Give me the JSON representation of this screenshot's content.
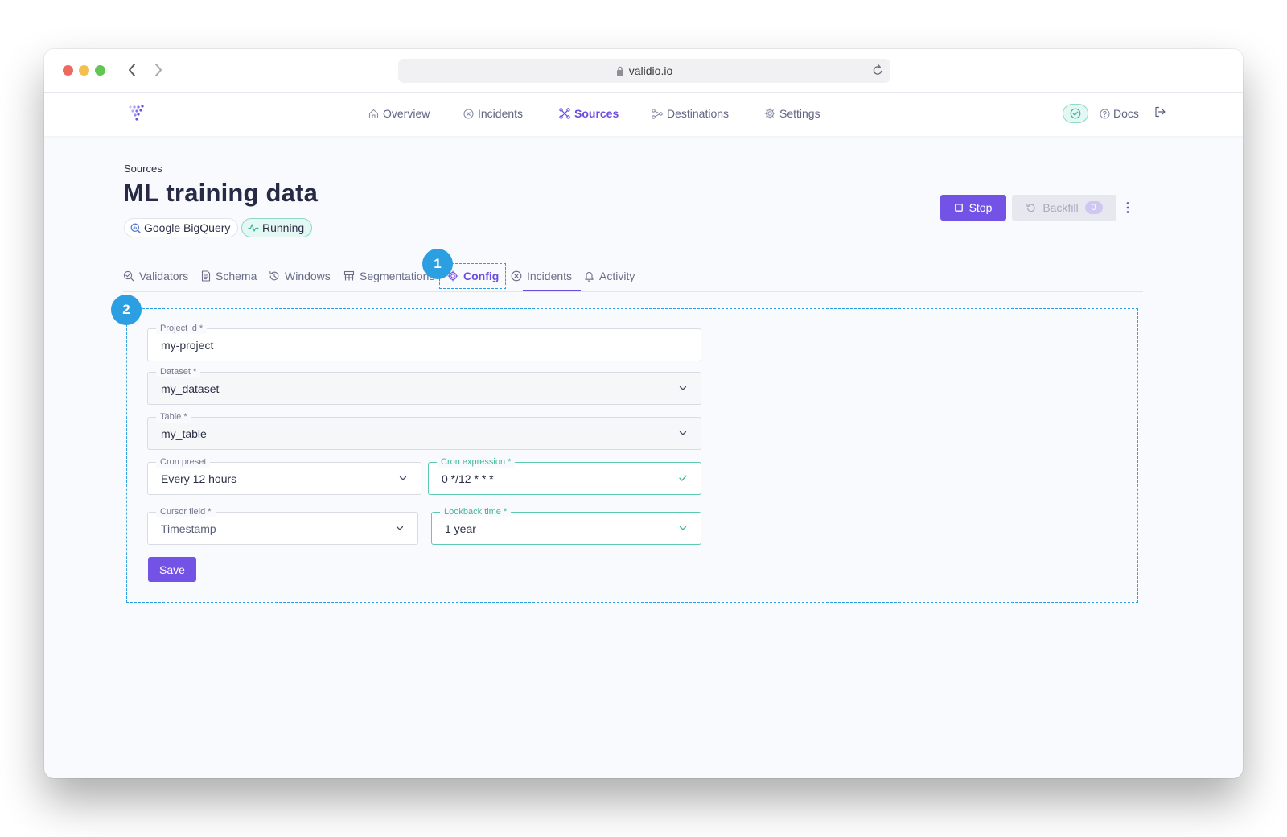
{
  "browser": {
    "url": "validio.io"
  },
  "nav": {
    "items": [
      {
        "label": "Overview",
        "icon": "home-icon"
      },
      {
        "label": "Incidents",
        "icon": "incident-icon"
      },
      {
        "label": "Sources",
        "icon": "sources-icon",
        "active": true
      },
      {
        "label": "Destinations",
        "icon": "destinations-icon"
      },
      {
        "label": "Settings",
        "icon": "gear-icon"
      }
    ],
    "docs_label": "Docs"
  },
  "page": {
    "breadcrumb": "Sources",
    "title": "ML training data",
    "source_chip": "Google BigQuery",
    "status_chip": "Running",
    "stop_label": "Stop",
    "backfill_label": "Backfill",
    "backfill_count": "0"
  },
  "tabs": [
    {
      "label": "Validators"
    },
    {
      "label": "Schema"
    },
    {
      "label": "Windows"
    },
    {
      "label": "Segmentations"
    },
    {
      "label": "Config",
      "active": true
    },
    {
      "label": "Incidents"
    },
    {
      "label": "Activity"
    }
  ],
  "annotations": {
    "marker1": "1",
    "marker2": "2"
  },
  "form": {
    "project_id": {
      "label": "Project id *",
      "value": "my-project"
    },
    "dataset": {
      "label": "Dataset *",
      "value": "my_dataset"
    },
    "table": {
      "label": "Table *",
      "value": "my_table"
    },
    "cron_preset": {
      "label": "Cron preset",
      "value": "Every 12 hours"
    },
    "cron_expression": {
      "label": "Cron expression *",
      "value": "0 */12 * * *"
    },
    "cursor_field": {
      "label": "Cursor field *",
      "value": "Timestamp"
    },
    "lookback_time": {
      "label": "Lookback time *",
      "value": "1 year"
    },
    "save_label": "Save"
  },
  "colors": {
    "accent": "#7353e6",
    "valid": "#5cc9b1",
    "annotation": "#2c9fe2"
  }
}
